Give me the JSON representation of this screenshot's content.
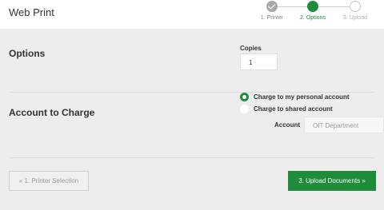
{
  "header": {
    "title": "Web Print"
  },
  "steps": [
    {
      "label": "1. Printer",
      "state": "done"
    },
    {
      "label": "2. Options",
      "state": "active"
    },
    {
      "label": "3. Upload",
      "state": "todo"
    }
  ],
  "options": {
    "title": "Options",
    "copies_label": "Copies",
    "copies_value": "1"
  },
  "account": {
    "title": "Account to Charge",
    "choices": [
      {
        "label": "Charge to my personal account",
        "selected": true
      },
      {
        "label": "Charge to shared account",
        "selected": false
      }
    ],
    "account_label": "Account",
    "account_placeholder": "OIT Department"
  },
  "nav": {
    "back_label": "« 1. Printer Selection",
    "next_label": "3. Upload Documents »"
  },
  "colors": {
    "accent": "#1e8c3a"
  }
}
